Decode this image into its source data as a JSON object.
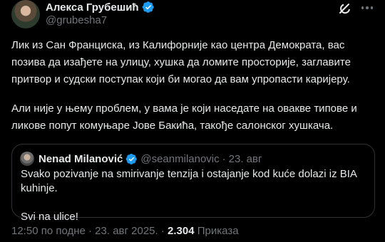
{
  "author": {
    "name": "Алекса Грубешић",
    "handle": "@grubesha7",
    "verified": true,
    "avatar_icon": "avatar-photo"
  },
  "tweet": {
    "paragraphs": [
      "Лик из Сан Франциска, из Калифорније као центра Демократа, вас позива да изађете на улицу, хушка да ломите просторије, заглавите притвор и судски поступак који би могао да вам упропасти каријеру.",
      "Али није у њему проблем, у вама је који наседате на овакве типове и ликове попут комуњаре Јове Бакића, такође салонског хушкача."
    ]
  },
  "quoted_tweet": {
    "name": "Nenad Milanović",
    "handle": "@seanmilanovic",
    "separator": "·",
    "date": "23. авг",
    "verified": true,
    "paragraphs": [
      "Svako pozivanje na smirivanje tenzija i ostajanje kod kuće dolazi iz BIA kuhinje.",
      "Svi na ulice!"
    ]
  },
  "meta": {
    "time_date": "12:50 по подне · 23. авг 2025. · ",
    "views_count": "2.304",
    "views_label": " Приказа"
  },
  "icons": {
    "verified": "verified-badge-icon",
    "grok": "grok-icon",
    "more": "more-dots-icon"
  },
  "colors": {
    "background": "#000000",
    "text": "#e7e9ea",
    "muted": "#71767b",
    "verified": "#1d9bf0",
    "border": "#2f3336"
  }
}
